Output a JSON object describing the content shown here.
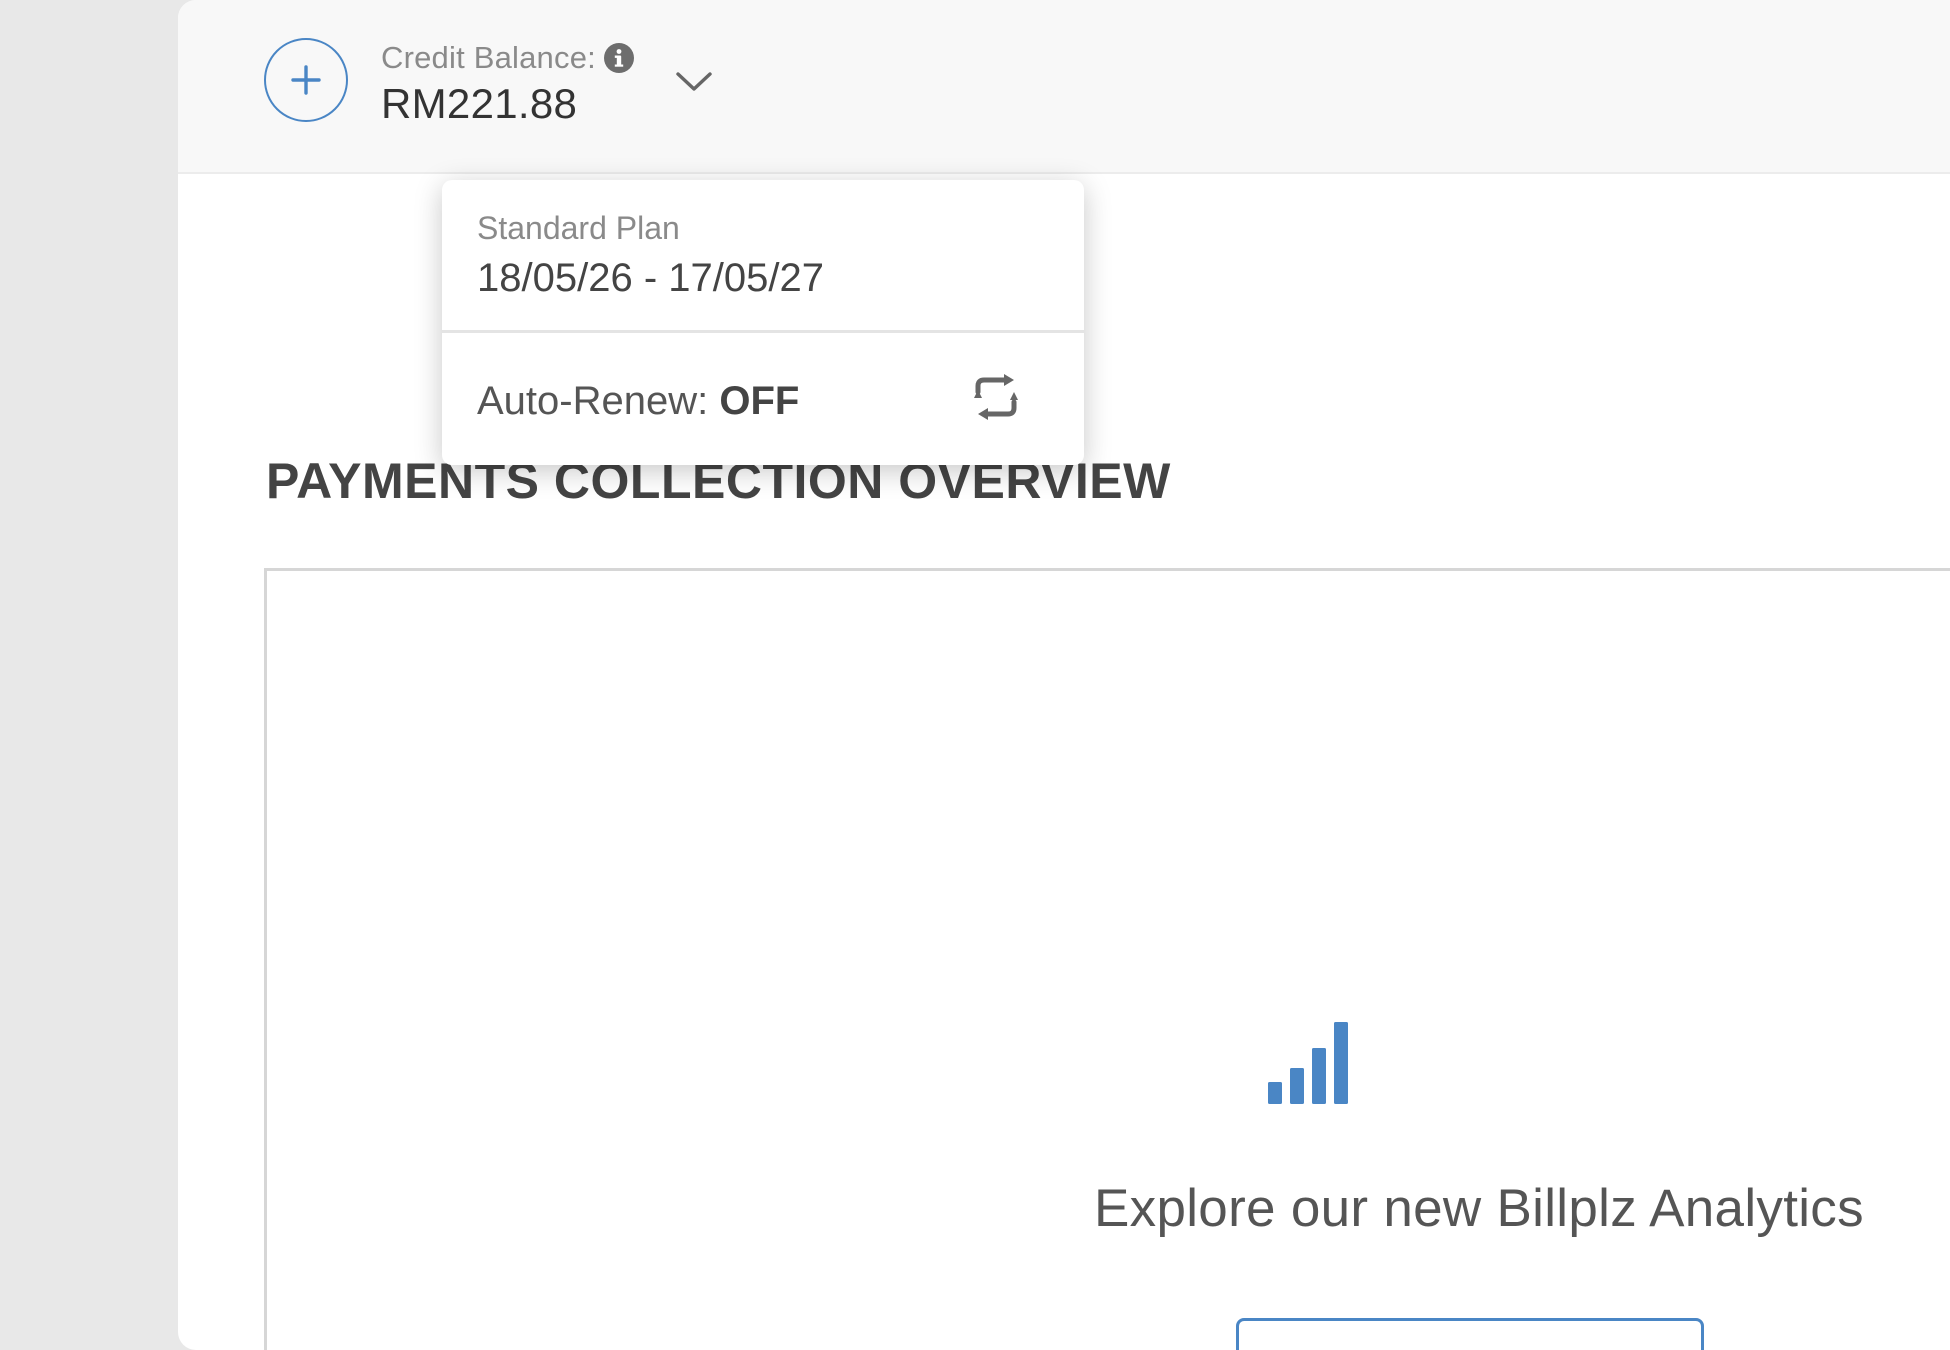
{
  "header": {
    "topup_icon": "plus-icon",
    "balance_label": "Credit Balance:",
    "balance_info_icon": "info-icon",
    "balance_value": "RM221.88",
    "toggle_icon": "chevron-down-icon"
  },
  "plan_dropdown": {
    "plan_name": "Standard Plan",
    "plan_period": "18/05/26 - 17/05/27",
    "auto_renew_label": "Auto-Renew:",
    "auto_renew_value": "OFF",
    "renew_icon": "refresh-icon"
  },
  "main": {
    "section_title": "PAYMENTS COLLECTION OVERVIEW",
    "analytics_icon": "bar-chart-icon",
    "analytics_text": "Explore our new Billplz Analytics"
  },
  "colors": {
    "accent": "#4a86c5",
    "background": "#e8e8e8",
    "topbar": "#f8f8f8"
  }
}
